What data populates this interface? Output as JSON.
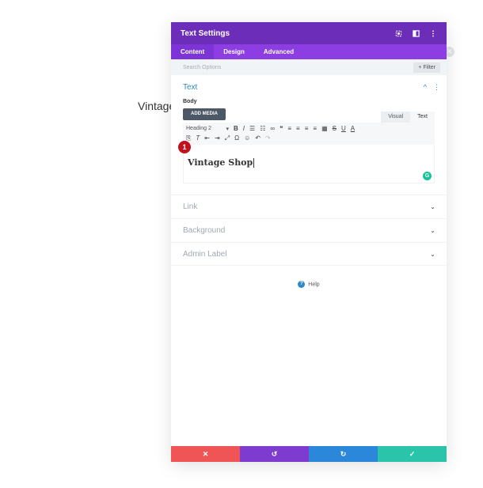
{
  "background": {
    "text": "Vintage"
  },
  "modal": {
    "title": "Text Settings",
    "header_icons": [
      "expand-icon",
      "sidebar-icon",
      "more-icon"
    ],
    "tabs": [
      {
        "label": "Content",
        "active": true
      },
      {
        "label": "Design",
        "active": false
      },
      {
        "label": "Advanced",
        "active": false
      }
    ],
    "search": {
      "placeholder": "Search Options",
      "filter_label": "+ Filter"
    },
    "text_section": {
      "title": "Text",
      "body_label": "Body",
      "add_media_label": "ADD MEDIA",
      "mode_tabs": [
        "Visual",
        "Text"
      ],
      "active_mode": "Text",
      "format_select": "Heading 2",
      "content": "Vintage Shop",
      "step_badge": "1"
    },
    "collapsed_groups": [
      "Link",
      "Background",
      "Admin Label"
    ],
    "help_label": "Help"
  },
  "colors": {
    "header": "#6c2eb9",
    "tabs_bar": "#8d3ee2",
    "accent_blue": "#2e89c5",
    "cancel": "#ef5555",
    "undo": "#7e3bd0",
    "redo": "#2b87da",
    "save": "#29c4a9"
  },
  "footer": {
    "buttons": [
      {
        "name": "cancel",
        "icon": "close-icon",
        "color": "#ef5555"
      },
      {
        "name": "undo",
        "icon": "undo-icon",
        "color": "#7e3bd0"
      },
      {
        "name": "redo",
        "icon": "redo-icon",
        "color": "#2b87da"
      },
      {
        "name": "save",
        "icon": "check-icon",
        "color": "#29c4a9"
      }
    ]
  }
}
